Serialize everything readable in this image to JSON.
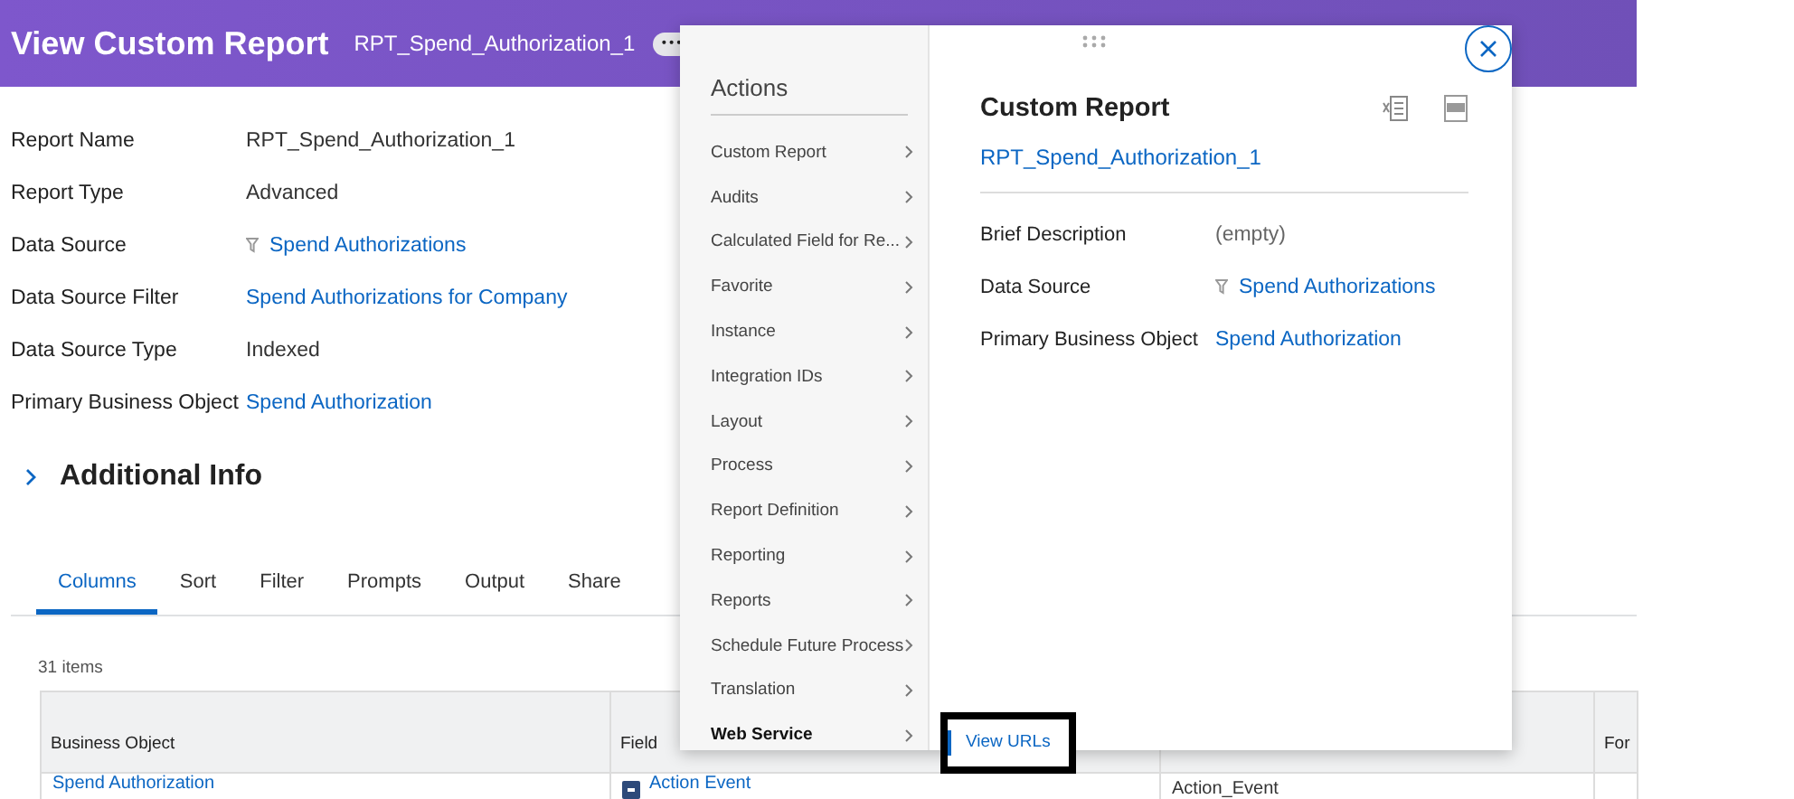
{
  "header": {
    "title": "View Custom Report",
    "subtitle": "RPT_Spend_Authorization_1",
    "more": "•••"
  },
  "fields": [
    {
      "label": "Report Name",
      "value": "RPT_Spend_Authorization_1",
      "kind": "text"
    },
    {
      "label": "Report Type",
      "value": "Advanced",
      "kind": "text"
    },
    {
      "label": "Data Source",
      "value": "Spend Authorizations",
      "kind": "source_link"
    },
    {
      "label": "Data Source Filter",
      "value": "Spend Authorizations for Company",
      "kind": "link"
    },
    {
      "label": "Data Source Type",
      "value": "Indexed",
      "kind": "text"
    },
    {
      "label": "Primary Business Object",
      "value": "Spend Authorization",
      "kind": "link"
    }
  ],
  "additional_info": {
    "title": "Additional Info",
    "expanded": false
  },
  "tabs": [
    {
      "label": "Columns",
      "selected": true
    },
    {
      "label": "Sort",
      "selected": false
    },
    {
      "label": "Filter",
      "selected": false
    },
    {
      "label": "Prompts",
      "selected": false
    },
    {
      "label": "Output",
      "selected": false
    },
    {
      "label": "Share",
      "selected": false
    }
  ],
  "item_count": "31 items",
  "table": {
    "columns": [
      "Business Object",
      "Field",
      "",
      "For"
    ],
    "rows": [
      [
        {
          "text": "Spend Authorization",
          "kind": "link"
        },
        {
          "text": "Action Event",
          "kind": "field_link"
        },
        {
          "text": "Action_Event",
          "kind": "text"
        }
      ]
    ]
  },
  "actions_popup": {
    "title": "Actions",
    "items": [
      {
        "label": "Custom Report",
        "selected": false
      },
      {
        "label": "Audits",
        "selected": false
      },
      {
        "label": "Calculated Field for Re...",
        "selected": false
      },
      {
        "label": "Favorite",
        "selected": false
      },
      {
        "label": "Instance",
        "selected": false
      },
      {
        "label": "Integration IDs",
        "selected": false
      },
      {
        "label": "Layout",
        "selected": false
      },
      {
        "label": "Process",
        "selected": false
      },
      {
        "label": "Report Definition",
        "selected": false
      },
      {
        "label": "Reporting",
        "selected": false
      },
      {
        "label": "Reports",
        "selected": false
      },
      {
        "label": "Schedule Future Process",
        "selected": false
      },
      {
        "label": "Translation",
        "selected": false
      },
      {
        "label": "Web Service",
        "selected": true
      }
    ],
    "submenu": [
      "View URLs"
    ],
    "detail": {
      "title": "Custom Report",
      "link": "RPT_Spend_Authorization_1",
      "fields": [
        {
          "label": "Brief Description",
          "value": "(empty)",
          "kind": "empty"
        },
        {
          "label": "Data Source",
          "value": "Spend Authorizations",
          "kind": "source_link"
        },
        {
          "label": "Primary Business Object",
          "value": "Spend Authorization",
          "kind": "link"
        }
      ]
    }
  }
}
